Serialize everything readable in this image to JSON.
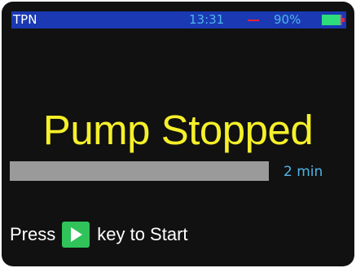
{
  "status_bar": {
    "title": "TPN",
    "time": "13:31",
    "battery_percent_label": "90%",
    "battery_level": 0.9,
    "icons": [
      "alarm-dash-icon",
      "battery-icon"
    ]
  },
  "main": {
    "headline": "Pump Stopped",
    "progress_level": 1.0,
    "duration": "2 min"
  },
  "instruction": {
    "prefix": "Press",
    "key_icon": "play-key-icon",
    "suffix": "key to Start"
  },
  "colors": {
    "status_bar_bg": "#1a39b3",
    "screen_bg": "#111111",
    "headline": "#f5f02a",
    "info_text": "#4fb4e6",
    "progress_fill": "#9a9a9a",
    "play_key": "#2fc35a",
    "battery_fill": "#2ddc7a",
    "battery_body": "#e7219a",
    "alarm_dash": "#e8223d"
  }
}
